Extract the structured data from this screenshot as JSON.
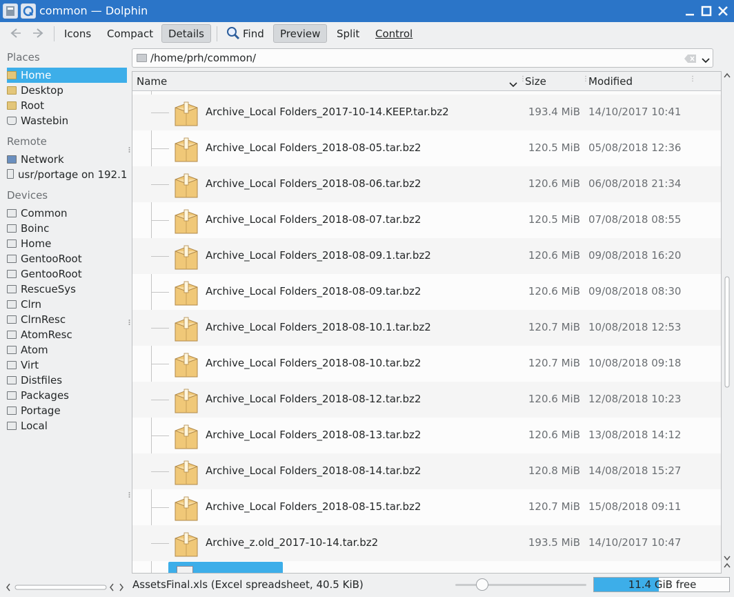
{
  "window": {
    "title": "common — Dolphin"
  },
  "toolbar": {
    "icons": "Icons",
    "compact": "Compact",
    "details": "Details",
    "find": "Find",
    "preview": "Preview",
    "split": "Split",
    "control": "Control"
  },
  "places": {
    "places_header": "Places",
    "places_items": [
      {
        "label": "Home",
        "icon": "home-folder-icon",
        "selected": true
      },
      {
        "label": "Desktop",
        "icon": "desktop-folder-icon"
      },
      {
        "label": "Root",
        "icon": "folder-icon"
      },
      {
        "label": "Wastebin",
        "icon": "trash-icon"
      }
    ],
    "remote_header": "Remote",
    "remote_items": [
      {
        "label": "Network",
        "icon": "network-icon"
      },
      {
        "label": "usr/portage on 192.1",
        "icon": "network-drive-icon"
      }
    ],
    "devices_header": "Devices",
    "devices_items": [
      {
        "label": "Common"
      },
      {
        "label": "Boinc"
      },
      {
        "label": "Home"
      },
      {
        "label": "GentooRoot"
      },
      {
        "label": "GentooRoot"
      },
      {
        "label": "RescueSys"
      },
      {
        "label": "Clrn"
      },
      {
        "label": "ClrnResc"
      },
      {
        "label": "AtomResc"
      },
      {
        "label": "Atom"
      },
      {
        "label": "Virt"
      },
      {
        "label": "Distfiles"
      },
      {
        "label": "Packages"
      },
      {
        "label": "Portage"
      },
      {
        "label": "Local"
      }
    ]
  },
  "location": {
    "path": "/home/prh/common/"
  },
  "columns": {
    "name": "Name",
    "size": "Size",
    "modified": "Modified"
  },
  "files": [
    {
      "name": "Archive_Local Folders_2017-10-14.KEEP.tar.bz2",
      "size": "193.4 MiB",
      "modified": "14/10/2017 10:41"
    },
    {
      "name": "Archive_Local Folders_2018-08-05.tar.bz2",
      "size": "120.5 MiB",
      "modified": "05/08/2018 12:36"
    },
    {
      "name": "Archive_Local Folders_2018-08-06.tar.bz2",
      "size": "120.6 MiB",
      "modified": "06/08/2018 21:34"
    },
    {
      "name": "Archive_Local Folders_2018-08-07.tar.bz2",
      "size": "120.5 MiB",
      "modified": "07/08/2018 08:55"
    },
    {
      "name": "Archive_Local Folders_2018-08-09.1.tar.bz2",
      "size": "120.6 MiB",
      "modified": "09/08/2018 16:20"
    },
    {
      "name": "Archive_Local Folders_2018-08-09.tar.bz2",
      "size": "120.6 MiB",
      "modified": "09/08/2018 08:30"
    },
    {
      "name": "Archive_Local Folders_2018-08-10.1.tar.bz2",
      "size": "120.7 MiB",
      "modified": "10/08/2018 12:53"
    },
    {
      "name": "Archive_Local Folders_2018-08-10.tar.bz2",
      "size": "120.7 MiB",
      "modified": "10/08/2018 09:18"
    },
    {
      "name": "Archive_Local Folders_2018-08-12.tar.bz2",
      "size": "120.6 MiB",
      "modified": "12/08/2018 10:23"
    },
    {
      "name": "Archive_Local Folders_2018-08-13.tar.bz2",
      "size": "120.6 MiB",
      "modified": "13/08/2018 14:12"
    },
    {
      "name": "Archive_Local Folders_2018-08-14.tar.bz2",
      "size": "120.8 MiB",
      "modified": "14/08/2018 15:27"
    },
    {
      "name": "Archive_Local Folders_2018-08-15.tar.bz2",
      "size": "120.7 MiB",
      "modified": "15/08/2018 09:11"
    },
    {
      "name": "Archive_z.old_2017-10-14.tar.bz2",
      "size": "193.5 MiB",
      "modified": "14/10/2017 10:47"
    }
  ],
  "status": {
    "text": "AssetsFinal.xls (Excel spreadsheet, 40.5 KiB)",
    "free_space": "11.4 GiB free",
    "used_fraction": 0.48,
    "zoom_fraction": 0.2
  },
  "colors": {
    "titlebar": "#2b75c8",
    "selection": "#3daee9"
  }
}
